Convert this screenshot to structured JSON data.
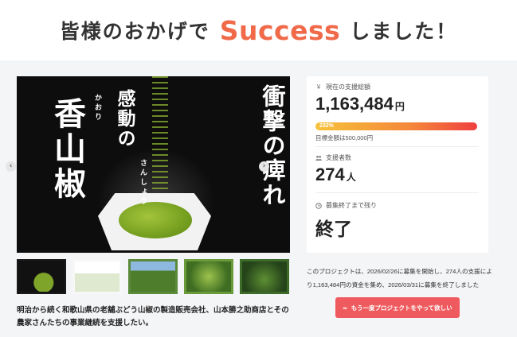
{
  "banner": {
    "prefix": "皆様のおかげで",
    "highlight": "Success",
    "suffix": "しました！"
  },
  "hero": {
    "text_left_big": "香山椒",
    "text_left_small": "感動の",
    "text_ruby_kaori": "かおり",
    "text_ruby_sansho": "さんしょう",
    "text_right": "衝撃の痺れ",
    "prev_icon": "‹",
    "next_icon": "›"
  },
  "thumbnails": [
    {
      "name": "thumb-1",
      "active": true
    },
    {
      "name": "thumb-2",
      "active": false
    },
    {
      "name": "thumb-3",
      "active": false
    },
    {
      "name": "thumb-4",
      "active": false
    },
    {
      "name": "thumb-5",
      "active": false
    }
  ],
  "summary": "明治から続く和歌山県の老舗ぶどう山椒の製造販売会社、山本勝之助商店とその農家さんたちの事業継続を支援したい。",
  "stats": {
    "total_label": "現在の支援総額",
    "total_icon": "¥",
    "total_value": "1,163,484",
    "total_unit": "円",
    "progress_text": "232%",
    "progress_percent": 232,
    "goal_text": "目標金額は500,000円",
    "supporters_label": "支援者数",
    "supporters_icon": "people-icon",
    "supporters_value": "274",
    "supporters_unit": "人",
    "remaining_label": "募集終了まで残り",
    "remaining_icon": "clock-icon",
    "remaining_value": "終了"
  },
  "project_note": "このプロジェクトは、2026/02/26に募集を開始し、274人の支援により1,163,484円の資金を集め、2026/03/31に募集を終了しました",
  "cta": {
    "icon": "∞",
    "label": "もう一度プロジェクトをやって欲しい"
  },
  "colors": {
    "accent": "#ef5a5e",
    "success_text": "#f06a4a",
    "success_highlight": "#fbe38a"
  }
}
